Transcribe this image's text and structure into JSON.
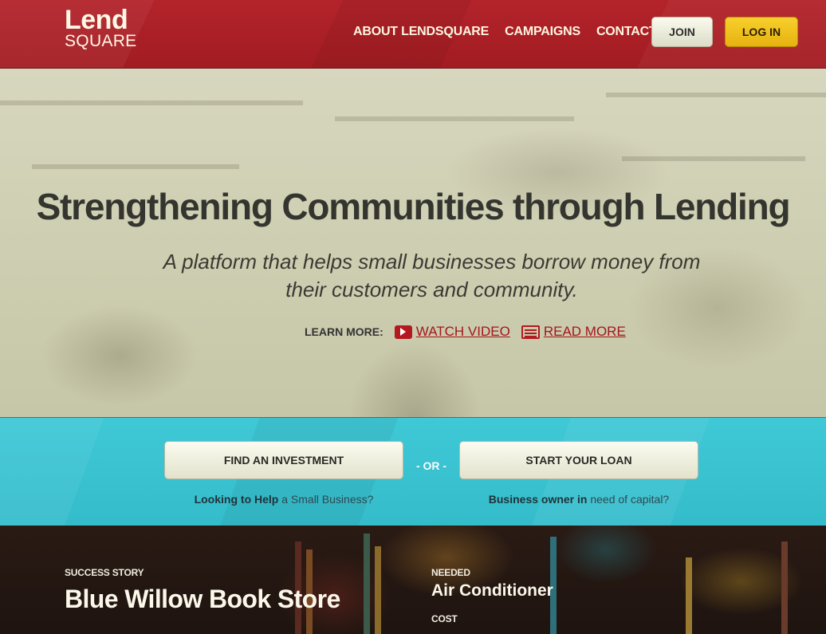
{
  "header": {
    "logo_top": "Lend",
    "logo_bottom": "SQUARE",
    "nav": [
      "ABOUT LENDSQUARE",
      "CAMPAIGNS",
      "CONTACT"
    ],
    "join_label": "JOIN",
    "login_label": "LOG IN"
  },
  "hero": {
    "title": "Strengthening Communities through Lending",
    "subtitle": "A platform that helps small businesses borrow money from their customers and community.",
    "learn_more_label": "LEARN MORE:",
    "watch_video_label": "WATCH VIDEO",
    "read_more_label": "READ MORE",
    "icons": {
      "video": "play-icon",
      "read": "document-icon"
    }
  },
  "cta": {
    "find_investment_label": "FIND AN INVESTMENT",
    "or_label": "- OR -",
    "start_loan_label": "START YOUR LOAN",
    "investor_caption_bold": "Looking to Help",
    "investor_caption_rest": " a Small Business?",
    "owner_caption_bold": "Business owner in",
    "owner_caption_rest": " need of capital?"
  },
  "story": {
    "label": "SUCCESS STORY",
    "title": "Blue Willow Book Store",
    "needed_label": "NEEDED",
    "needed_value": "Air Conditioner",
    "cost_label": "COST"
  },
  "colors": {
    "header_red": "#a91f26",
    "accent_red": "#b3191f",
    "login_yellow": "#f0c01e",
    "cta_teal": "#3ac2d1",
    "hero_cream": "#d2d2b8",
    "title_dark": "#353530"
  }
}
